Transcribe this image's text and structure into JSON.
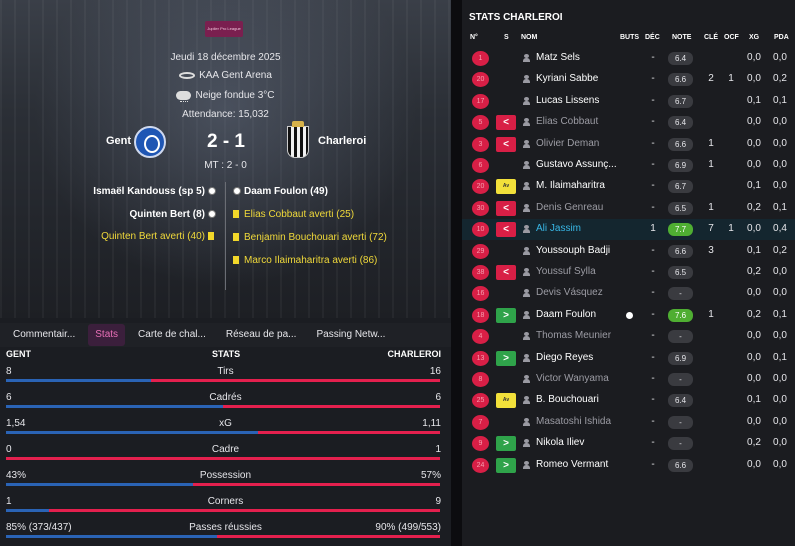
{
  "match": {
    "competition_logo_text": "Jupiler Pro League",
    "date": "Jeudi 18 décembre 2025",
    "stadium": "KAA Gent Arena",
    "weather": "Neige fondue 3°C",
    "attendance": "Attendance: 15,032",
    "home_team": "Gent",
    "away_team": "Charleroi",
    "score": "2 - 1",
    "half_time": "MT : 2 - 0"
  },
  "events": {
    "left": [
      {
        "text": "Ismaël Kandouss (sp 5)",
        "kind": "goal"
      },
      {
        "text": "Quinten Bert (8)",
        "kind": "goal"
      },
      {
        "text": "Quinten Bert averti (40)",
        "kind": "yellow"
      }
    ],
    "right": [
      {
        "text": "Daam Foulon (49)",
        "kind": "goal"
      },
      {
        "text": "Elias Cobbaut averti (25)",
        "kind": "yellow"
      },
      {
        "text": "Benjamin Bouchouari averti (72)",
        "kind": "yellow"
      },
      {
        "text": "Marco Ilaimaharitra averti (86)",
        "kind": "yellow"
      }
    ]
  },
  "tabs": [
    "Commentair...",
    "Stats",
    "Carte de chal...",
    "Réseau de pa...",
    "Passing Netw..."
  ],
  "active_tab": 1,
  "stats_header": {
    "home": "GENT",
    "title": "STATS",
    "away": "CHARLEROI"
  },
  "stats": [
    {
      "label": "Tirs",
      "home": "8",
      "away": "16",
      "home_share": 0.333
    },
    {
      "label": "Cadrés",
      "home": "6",
      "away": "6",
      "home_share": 0.5
    },
    {
      "label": "xG",
      "home": "1,54",
      "away": "1,11",
      "home_share": 0.581
    },
    {
      "label": "Cadre",
      "home": "0",
      "away": "1",
      "home_share": 0.0
    },
    {
      "label": "Possession",
      "home": "43%",
      "away": "57%",
      "home_share": 0.43
    },
    {
      "label": "Corners",
      "home": "1",
      "away": "9",
      "home_share": 0.1
    },
    {
      "label": "Passes réussies",
      "home": "85% (373/437)",
      "away": "90% (499/553)",
      "home_share": 0.486
    }
  ],
  "right_panel": {
    "title": "STATS CHARLEROI",
    "columns": [
      "N°",
      "S",
      "NOM",
      "BUTS",
      "DÉC",
      "NOTE",
      "CLÉ",
      "OCF",
      "XG",
      "PDA"
    ]
  },
  "players": [
    {
      "num": "1",
      "sub": "",
      "name": "Matz Sels",
      "bench": false,
      "hl": false,
      "goal": false,
      "dec": "-",
      "note": "6.4",
      "note_style": "",
      "cle": "",
      "ocf": "",
      "xg": "0,0",
      "pda": "0,0"
    },
    {
      "num": "20",
      "sub": "",
      "name": "Kyriani Sabbe",
      "bench": false,
      "hl": false,
      "goal": false,
      "dec": "-",
      "note": "6.6",
      "note_style": "",
      "cle": "2",
      "ocf": "1",
      "xg": "0,0",
      "pda": "0,2"
    },
    {
      "num": "17",
      "sub": "",
      "name": "Lucas Lissens",
      "bench": false,
      "hl": false,
      "goal": false,
      "dec": "-",
      "note": "6.7",
      "note_style": "",
      "cle": "",
      "ocf": "",
      "xg": "0,1",
      "pda": "0,1"
    },
    {
      "num": "5",
      "sub": "out",
      "name": "Elias Cobbaut",
      "bench": true,
      "hl": false,
      "goal": false,
      "dec": "-",
      "note": "6.4",
      "note_style": "",
      "cle": "",
      "ocf": "",
      "xg": "0,0",
      "pda": "0,0"
    },
    {
      "num": "3",
      "sub": "out",
      "name": "Olivier Deman",
      "bench": true,
      "hl": false,
      "goal": false,
      "dec": "-",
      "note": "6.6",
      "note_style": "",
      "cle": "1",
      "ocf": "",
      "xg": "0,0",
      "pda": "0,0"
    },
    {
      "num": "6",
      "sub": "",
      "name": "Gustavo Assunç...",
      "bench": false,
      "hl": false,
      "goal": false,
      "dec": "-",
      "note": "6.9",
      "note_style": "",
      "cle": "1",
      "ocf": "",
      "xg": "0,0",
      "pda": "0,0"
    },
    {
      "num": "20",
      "sub": "yc",
      "name": "M. Ilaimaharitra",
      "bench": false,
      "hl": false,
      "goal": false,
      "dec": "-",
      "note": "6.7",
      "note_style": "",
      "cle": "",
      "ocf": "",
      "xg": "0,1",
      "pda": "0,0"
    },
    {
      "num": "30",
      "sub": "out",
      "name": "Denis Genreau",
      "bench": true,
      "hl": false,
      "goal": false,
      "dec": "-",
      "note": "6.5",
      "note_style": "",
      "cle": "1",
      "ocf": "",
      "xg": "0,2",
      "pda": "0,1"
    },
    {
      "num": "10",
      "sub": "out",
      "name": "Ali Jassim",
      "bench": false,
      "hl": true,
      "goal": false,
      "dec": "1",
      "note": "7.7",
      "note_style": "good",
      "cle": "7",
      "ocf": "1",
      "xg": "0,0",
      "pda": "0,4"
    },
    {
      "num": "29",
      "sub": "",
      "name": "Youssouph Badji",
      "bench": false,
      "hl": false,
      "goal": false,
      "dec": "-",
      "note": "6.6",
      "note_style": "",
      "cle": "3",
      "ocf": "",
      "xg": "0,1",
      "pda": "0,2"
    },
    {
      "num": "38",
      "sub": "out",
      "name": "Youssuf Sylla",
      "bench": true,
      "hl": false,
      "goal": false,
      "dec": "-",
      "note": "6.5",
      "note_style": "",
      "cle": "",
      "ocf": "",
      "xg": "0,2",
      "pda": "0,0"
    },
    {
      "num": "16",
      "sub": "",
      "name": "Devis Vásquez",
      "bench": true,
      "hl": false,
      "goal": false,
      "dec": "-",
      "note": "-",
      "note_style": "",
      "cle": "",
      "ocf": "",
      "xg": "0,0",
      "pda": "0,0"
    },
    {
      "num": "18",
      "sub": "in",
      "name": "Daam Foulon",
      "bench": false,
      "hl": false,
      "goal": true,
      "dec": "-",
      "note": "7.6",
      "note_style": "best",
      "cle": "1",
      "ocf": "",
      "xg": "0,2",
      "pda": "0,1"
    },
    {
      "num": "4",
      "sub": "",
      "name": "Thomas Meunier",
      "bench": true,
      "hl": false,
      "goal": false,
      "dec": "-",
      "note": "-",
      "note_style": "",
      "cle": "",
      "ocf": "",
      "xg": "0,0",
      "pda": "0,0"
    },
    {
      "num": "13",
      "sub": "in",
      "name": "Diego Reyes",
      "bench": false,
      "hl": false,
      "goal": false,
      "dec": "-",
      "note": "6.9",
      "note_style": "",
      "cle": "",
      "ocf": "",
      "xg": "0,0",
      "pda": "0,1"
    },
    {
      "num": "8",
      "sub": "",
      "name": "Victor Wanyama",
      "bench": true,
      "hl": false,
      "goal": false,
      "dec": "-",
      "note": "-",
      "note_style": "",
      "cle": "",
      "ocf": "",
      "xg": "0,0",
      "pda": "0,0"
    },
    {
      "num": "25",
      "sub": "yc",
      "name": "B. Bouchouari",
      "bench": false,
      "hl": false,
      "goal": false,
      "dec": "-",
      "note": "6.4",
      "note_style": "",
      "cle": "",
      "ocf": "",
      "xg": "0,1",
      "pda": "0,0"
    },
    {
      "num": "7",
      "sub": "",
      "name": "Masatoshi Ishida",
      "bench": true,
      "hl": false,
      "goal": false,
      "dec": "-",
      "note": "-",
      "note_style": "",
      "cle": "",
      "ocf": "",
      "xg": "0,0",
      "pda": "0,0"
    },
    {
      "num": "9",
      "sub": "in",
      "name": "Nikola Iliev",
      "bench": false,
      "hl": false,
      "goal": false,
      "dec": "-",
      "note": "-",
      "note_style": "",
      "cle": "",
      "ocf": "",
      "xg": "0,2",
      "pda": "0,0"
    },
    {
      "num": "24",
      "sub": "in",
      "name": "Romeo Vermant",
      "bench": false,
      "hl": false,
      "goal": false,
      "dec": "-",
      "note": "6.6",
      "note_style": "",
      "cle": "",
      "ocf": "",
      "xg": "0,0",
      "pda": "0,0"
    }
  ],
  "colors": {
    "home_bar": "#2a63b5",
    "away_bar": "#e4204e",
    "accent": "#e86fb7",
    "rating_good": "#4fae32"
  }
}
